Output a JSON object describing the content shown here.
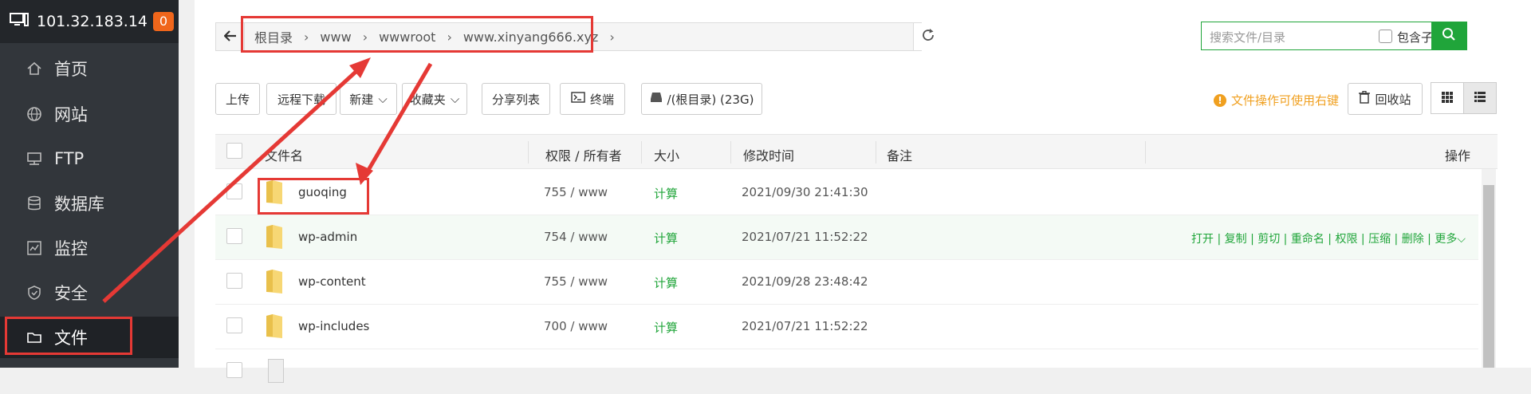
{
  "sidebar": {
    "server_ip": "101.32.183.14",
    "badge_count": "0",
    "items": [
      {
        "label": "首页",
        "icon": "home-icon"
      },
      {
        "label": "网站",
        "icon": "globe-icon"
      },
      {
        "label": "FTP",
        "icon": "ftp-icon"
      },
      {
        "label": "数据库",
        "icon": "database-icon"
      },
      {
        "label": "监控",
        "icon": "monitor-icon"
      },
      {
        "label": "安全",
        "icon": "shield-icon"
      },
      {
        "label": "文件",
        "icon": "folder-icon",
        "active": true
      }
    ]
  },
  "breadcrumb": {
    "parts": [
      "根目录",
      "www",
      "wwwroot",
      "www.xinyang666.xyz"
    ]
  },
  "search": {
    "placeholder": "搜索文件/目录",
    "include_sub_label": "包含子目录"
  },
  "toolbar": {
    "upload": "上传",
    "remote_download": "远程下载",
    "new": "新建",
    "favorites": "收藏夹",
    "share_list": "分享列表",
    "terminal": "终端",
    "disk": "/(根目录) (23G)",
    "hint": "文件操作可使用右键",
    "recycle_bin": "回收站"
  },
  "table": {
    "headers": {
      "name": "文件名",
      "perm_owner": "权限 / 所有者",
      "size": "大小",
      "mtime": "修改时间",
      "note": "备注",
      "actions": "操作"
    },
    "rows": [
      {
        "name": "guoqing",
        "perm": "755 / www",
        "size": "计算",
        "mtime": "2021/09/30 21:41:30"
      },
      {
        "name": "wp-admin",
        "perm": "754 / www",
        "size": "计算",
        "mtime": "2021/07/21 11:52:22",
        "ops": "打开 | 复制 | 剪切 | 重命名 | 权限 | 压缩 | 删除 | 更多"
      },
      {
        "name": "wp-content",
        "perm": "755 / www",
        "size": "计算",
        "mtime": "2021/09/28 23:48:42"
      },
      {
        "name": "wp-includes",
        "perm": "700 / www",
        "size": "计算",
        "mtime": "2021/07/21 11:52:22"
      }
    ]
  },
  "colors": {
    "accent": "#20a53a",
    "annotation": "#e53935",
    "sidebar_bg": "#32363b",
    "badge": "#f0661b",
    "hint": "#f0a020"
  }
}
